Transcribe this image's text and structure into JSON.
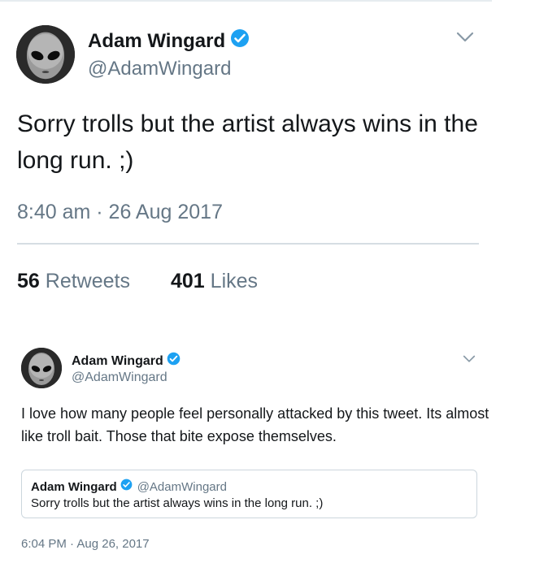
{
  "tweet_main": {
    "display_name": "Adam Wingard",
    "handle": "@AdamWingard",
    "text": "Sorry trolls but the artist always wins in the long run. ;)",
    "timestamp": "8:40 am · 26 Aug 2017",
    "retweets_count": "56",
    "retweets_label": "Retweets",
    "likes_count": "401",
    "likes_label": "Likes"
  },
  "tweet_reply": {
    "display_name": "Adam Wingard",
    "handle": "@AdamWingard",
    "text": "I love how many people feel personally attacked by this tweet. Its almost like troll bait. Those that bite expose themselves.",
    "quoted": {
      "display_name": "Adam Wingard",
      "handle": "@AdamWingard",
      "text": "Sorry trolls but the artist always wins in the long run. ;)"
    },
    "timestamp": "6:04 PM · Aug 26, 2017"
  },
  "icons": {
    "verified": "verified-badge-icon",
    "chevron": "chevron-down-icon"
  },
  "colors": {
    "verified_blue": "#1da1f2",
    "muted_text": "#657786",
    "divider": "#d6dde3"
  }
}
